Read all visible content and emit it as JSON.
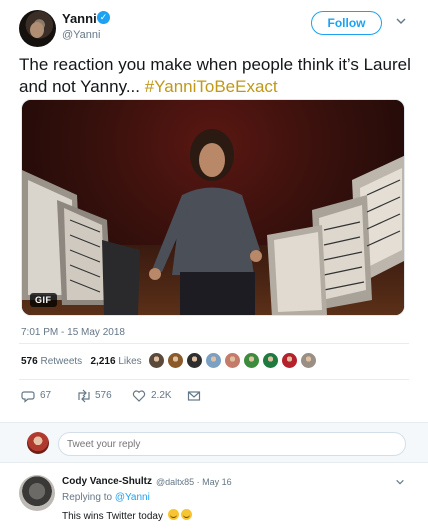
{
  "header": {
    "name": "Yanni",
    "handle": "@Yanni",
    "verified_icon": "verified-badge-icon",
    "follow_label": "Follow",
    "caret_icon": "chevron-down-icon"
  },
  "tweet": {
    "text_plain": "The reaction you make when people think it’s Laurel and not Yanny... ",
    "hashtag": "#YanniToBeExact",
    "media_badge": "GIF",
    "timestamp": "7:01 PM - 15 May 2018"
  },
  "stats": {
    "retweets_count": "576",
    "retweets_label": "Retweets",
    "likes_count": "2,216",
    "likes_label": "Likes",
    "liker_colors": [
      "#5b4a3c",
      "#8a5a2b",
      "#2e2e2e",
      "#7aa0c4",
      "#c57b6a",
      "#3d8b3d",
      "#1e7a3e",
      "#b5222c",
      "#9a8f85"
    ]
  },
  "actions": {
    "reply_count": "67",
    "retweet_count": "576",
    "like_count": "2.2K",
    "reply_icon": "reply-icon",
    "retweet_icon": "retweet-icon",
    "like_icon": "heart-icon",
    "dm_icon": "envelope-icon"
  },
  "reply_box": {
    "placeholder": "Tweet your reply"
  },
  "reply": {
    "name": "Cody Vance-Shultz",
    "meta": "@daltx85 · May 16",
    "replying_prefix": "Replying to ",
    "replying_mention": "@Yanni",
    "text": "This wins Twitter today",
    "emojis": [
      "grinning-face",
      "grinning-face"
    ]
  },
  "colors": {
    "accent": "#1da1f2",
    "hashtag": "#c0981a",
    "muted": "#657786"
  }
}
